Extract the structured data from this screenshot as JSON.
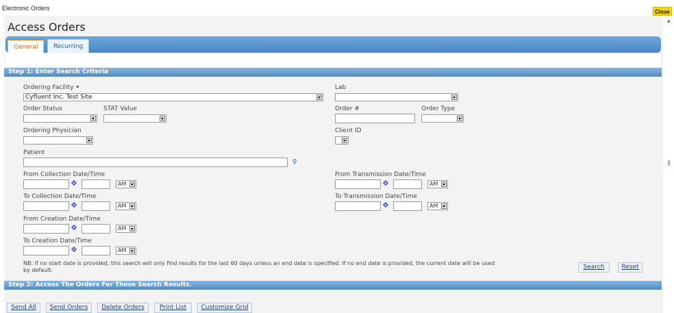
{
  "window": {
    "title": "Electronic Orders",
    "close_label": "Close"
  },
  "page": {
    "title": "Access Orders"
  },
  "tabs": [
    {
      "label": "General"
    },
    {
      "label": "Recurring"
    }
  ],
  "step1": {
    "title": "Step 1: Enter Search Criteria"
  },
  "fields": {
    "ordering_facility": {
      "label": "Ordering Facility",
      "required_marker": "•",
      "value": "Cyfluent Inc. Test Site"
    },
    "lab": {
      "label": "Lab",
      "value": ""
    },
    "order_status": {
      "label": "Order Status",
      "value": ""
    },
    "stat_value": {
      "label": "STAT Value",
      "value": ""
    },
    "order_number": {
      "label": "Order #",
      "value": ""
    },
    "order_type": {
      "label": "Order Type",
      "value": ""
    },
    "ordering_physician": {
      "label": "Ordering Physician",
      "value": ""
    },
    "client_id": {
      "label": "Client ID",
      "value": ""
    },
    "patient": {
      "label": "Patient",
      "value": ""
    },
    "from_collection": {
      "label": "From Collection Date/Time",
      "ampm": "AM"
    },
    "to_collection": {
      "label": "To Collection Date/Time",
      "ampm": "AM"
    },
    "from_creation": {
      "label": "From Creation Date/Time",
      "ampm": "AM"
    },
    "to_creation": {
      "label": "To Creation Date/Time",
      "ampm": "AM"
    },
    "from_transmission": {
      "label": "From Transmission Date/Time",
      "ampm": "AM"
    },
    "to_transmission": {
      "label": "To Transmission Date/Time",
      "ampm": "AM"
    }
  },
  "note": "NB: If no start date is provided, this search will only find results for the last 60 days unless an end date is specified. If no end date is provided, the current date will be used by default.",
  "actions": {
    "search": "Search",
    "reset": "Reset"
  },
  "step2": {
    "title": "Step 2: Access The Orders For These Search Results."
  },
  "bottom_buttons": [
    {
      "label": "Send All"
    },
    {
      "label": "Send Orders"
    },
    {
      "label": "Delete Orders"
    },
    {
      "label": "Print List"
    },
    {
      "label": "Customize Grid"
    }
  ],
  "icons": {
    "lookup": "magnifier-icon",
    "calendar": "calendar-icon",
    "dropdown": "chevron-down-icon"
  }
}
